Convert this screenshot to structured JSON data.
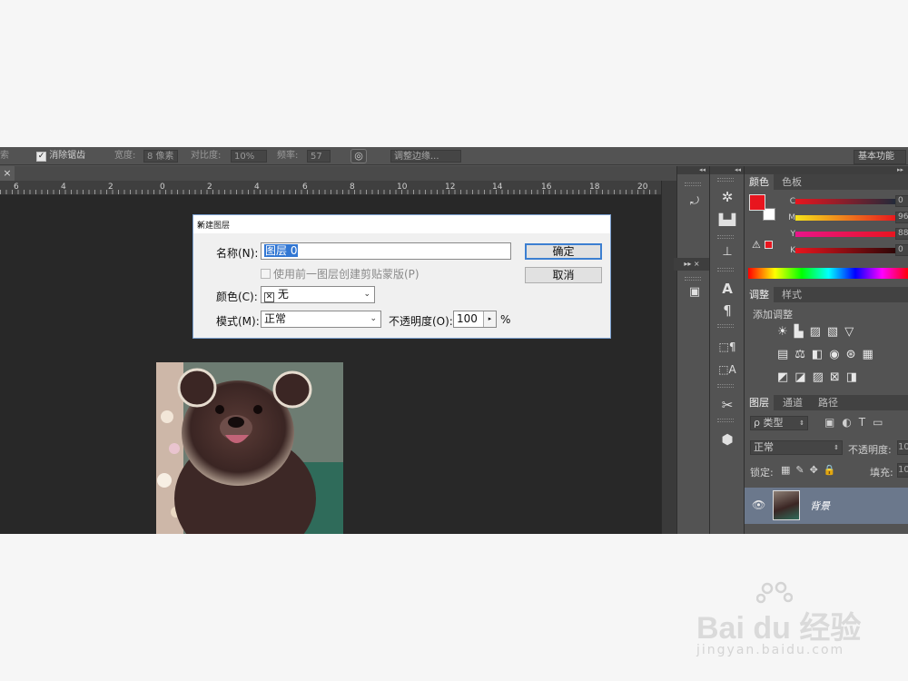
{
  "options_bar": {
    "truncated_left": "索",
    "antialias_label": "消除锯齿",
    "width_label": "宽度:",
    "width_value": "8 像素",
    "contrast_label": "对比度:",
    "contrast_value": "10%",
    "frequency_label": "频率:",
    "frequency_value": "57",
    "refine_edge_label": "调整边缘...",
    "workspace_label": "基本功能"
  },
  "ruler_ticks": [
    "6",
    "4",
    "2",
    "0",
    "2",
    "4",
    "6",
    "8",
    "10",
    "12",
    "14",
    "16",
    "18",
    "20"
  ],
  "dialog": {
    "title": "新建图层",
    "name_label": "名称(N):",
    "name_value": "图层 0",
    "clip_label": "使用前一图层创建剪贴蒙版(P)",
    "color_label": "颜色(C):",
    "color_value": "无",
    "mode_label": "模式(M):",
    "mode_value": "正常",
    "opacity_label": "不透明度(O):",
    "opacity_value": "100",
    "percent": "%",
    "ok_label": "确定",
    "cancel_label": "取消"
  },
  "color_panel": {
    "tabs": [
      "颜色",
      "色板"
    ],
    "channels": [
      {
        "label": "C",
        "value": "0"
      },
      {
        "label": "M",
        "value": "96"
      },
      {
        "label": "Y",
        "value": "88"
      },
      {
        "label": "K",
        "value": "0"
      }
    ],
    "foreground_color": "#e8151e",
    "background_color": "#ffffff"
  },
  "adjustments_panel": {
    "tabs": [
      "调整",
      "样式"
    ],
    "add_label": "添加调整"
  },
  "layers_panel": {
    "tabs": [
      "图层",
      "通道",
      "路径"
    ],
    "filter_label": "ρ 类型",
    "blend_mode": "正常",
    "opacity_label": "不透明度:",
    "opacity_value": "10",
    "lock_label": "锁定:",
    "fill_label": "填充:",
    "fill_value": "10",
    "layer_name": "背景"
  },
  "watermark": {
    "brand": "Bai du 经验",
    "url": "jingyan.baidu.com"
  }
}
